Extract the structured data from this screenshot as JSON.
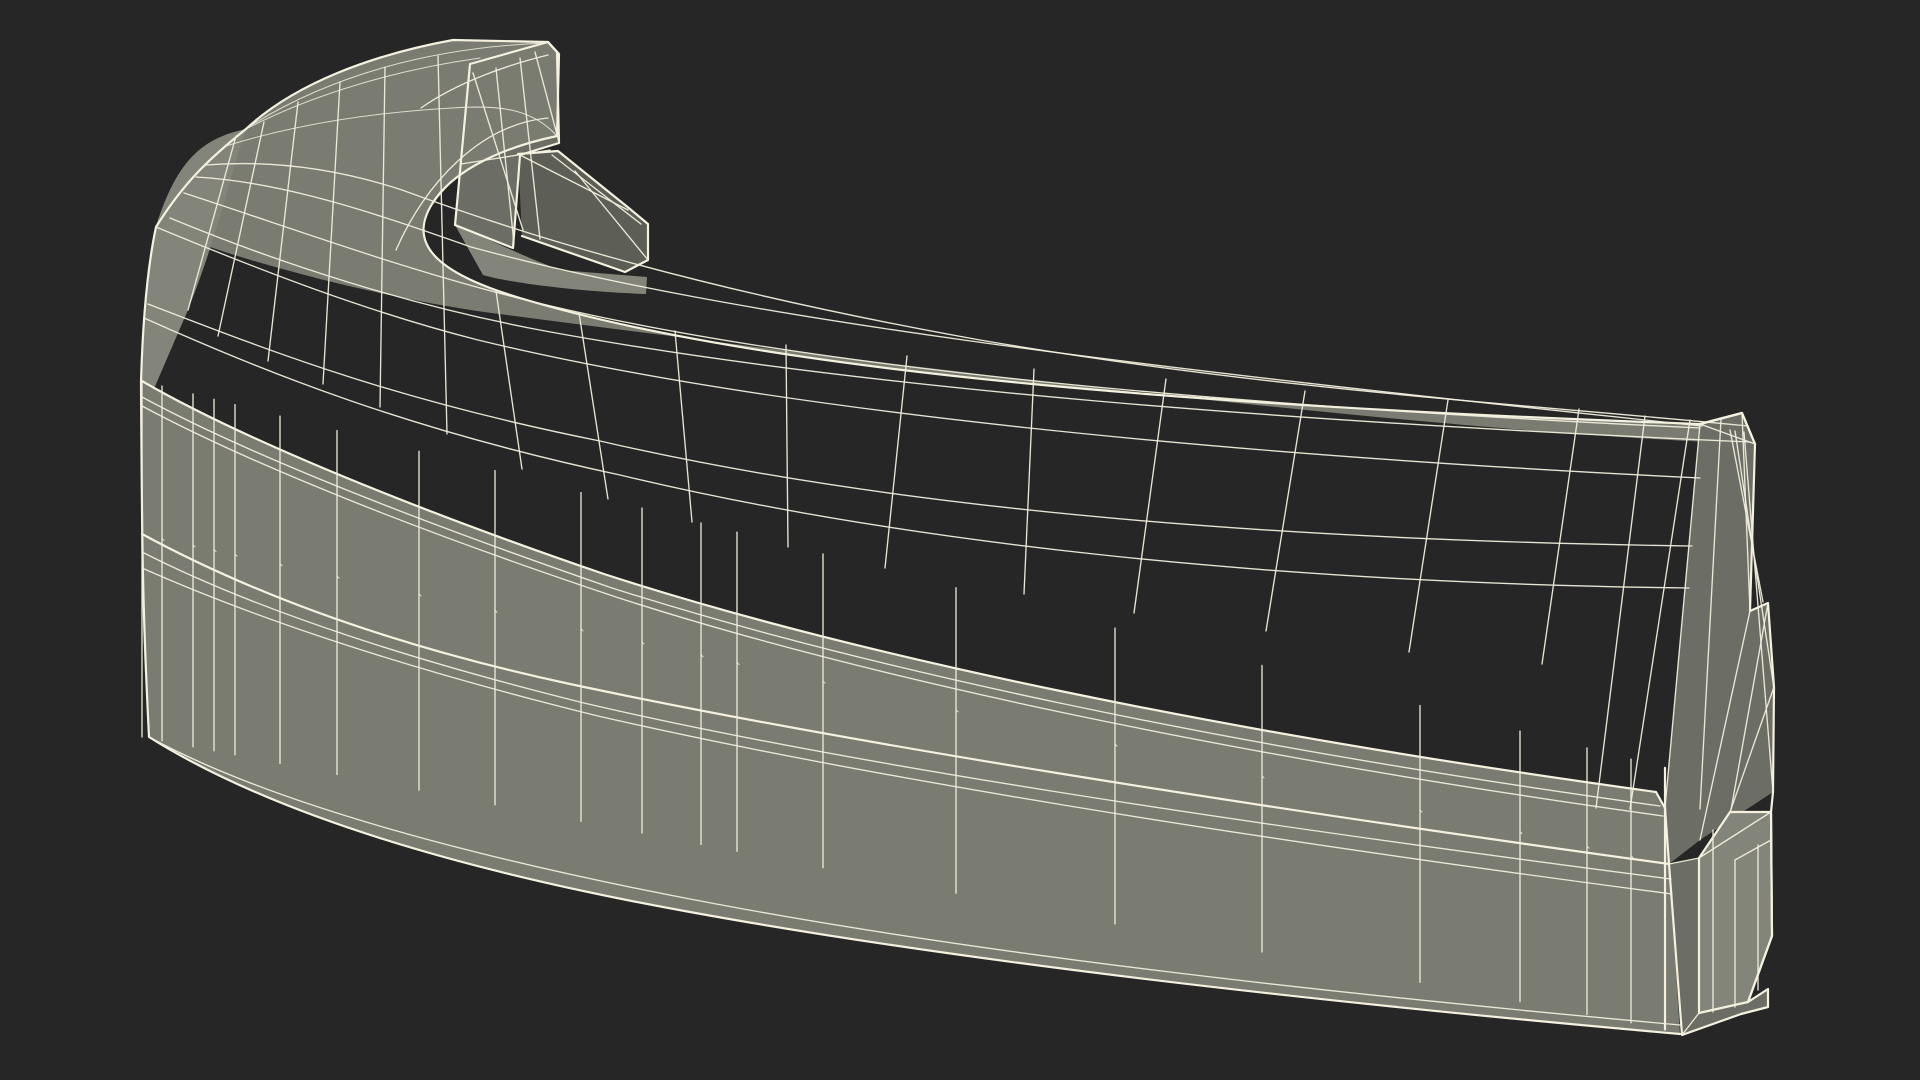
{
  "scene": {
    "background_color": "#262626",
    "model_base_color": "#7a7b71",
    "wire_color": "#f1eedc",
    "shadow_color": "#5d5e56",
    "model_kind": "wireframe-render"
  }
}
